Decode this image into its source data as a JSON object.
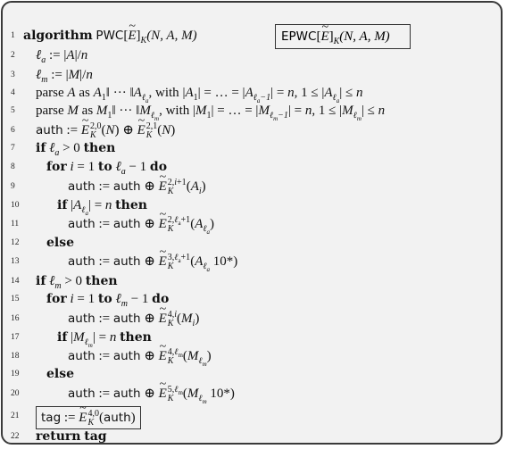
{
  "algorithm": {
    "title_keyword": "algorithm",
    "title_name": "PWC",
    "title_params": "(N, A, M)",
    "boxed_variant": {
      "name": "EPWC",
      "params": "(N, A, M)"
    },
    "lines": [
      {
        "num": "1",
        "text": "algorithm PWC[Ẽ]K(N, A, M)"
      },
      {
        "num": "2",
        "text": "ℓa := |A|/n"
      },
      {
        "num": "3",
        "text": "ℓm := |M|/n"
      },
      {
        "num": "4",
        "text": "parse A as A1‖ ··· ‖Aℓa, with |A1| = ... = |Aℓa−1| = n, 1 ≤ |Aℓa| ≤ n"
      },
      {
        "num": "5",
        "text": "parse M as M1‖ ··· ‖Mℓm, with |M1| = ... = |Mℓm−1| = n, 1 ≤ |Mℓm| ≤ n"
      },
      {
        "num": "6",
        "text": "auth := Ẽ^{2,0}_K(N) ⊕ Ẽ^{2,1}_K(N)"
      },
      {
        "num": "7",
        "text": "if ℓa > 0 then"
      },
      {
        "num": "8",
        "text": "for i = 1 to ℓa − 1 do"
      },
      {
        "num": "9",
        "text": "auth := auth ⊕ Ẽ^{2,i+1}_K(Ai)"
      },
      {
        "num": "10",
        "text": "if |Aℓa| = n then"
      },
      {
        "num": "11",
        "text": "auth := auth ⊕ Ẽ^{2,ℓa+1}_K(Aℓa)"
      },
      {
        "num": "12",
        "text": "else"
      },
      {
        "num": "13",
        "text": "auth := auth ⊕ Ẽ^{3,ℓa+1}_K(Aℓa 10*)"
      },
      {
        "num": "14",
        "text": "if ℓm > 0 then"
      },
      {
        "num": "15",
        "text": "for i = 1 to ℓm − 1 do"
      },
      {
        "num": "16",
        "text": "auth := auth ⊕ Ẽ^{4,i}_K(Mi)"
      },
      {
        "num": "17",
        "text": "if |Mℓm| = n then"
      },
      {
        "num": "18",
        "text": "auth := auth ⊕ Ẽ^{4,ℓm}_K(Mℓm)"
      },
      {
        "num": "19",
        "text": "else"
      },
      {
        "num": "20",
        "text": "auth := auth ⊕ Ẽ^{5,ℓm}_K(Mℓm 10*)"
      },
      {
        "num": "21",
        "text": "tag := Ẽ^{4,0}_K(auth)"
      },
      {
        "num": "22",
        "text": "return tag"
      }
    ]
  },
  "tokens": {
    "algorithm": "algorithm",
    "parse": "parse",
    "as": "as",
    "with": "with",
    "if": "if",
    "then": "then",
    "for": "for",
    "to": "to",
    "do": "do",
    "else": "else",
    "return": "return",
    "auth": "auth",
    "tag": "tag",
    "assign": ":=",
    "xor": "⊕",
    "tenstar": "10*"
  },
  "colors": {
    "background": "#f2f2f2",
    "border": "#3a3a3a",
    "text": "#111111"
  }
}
